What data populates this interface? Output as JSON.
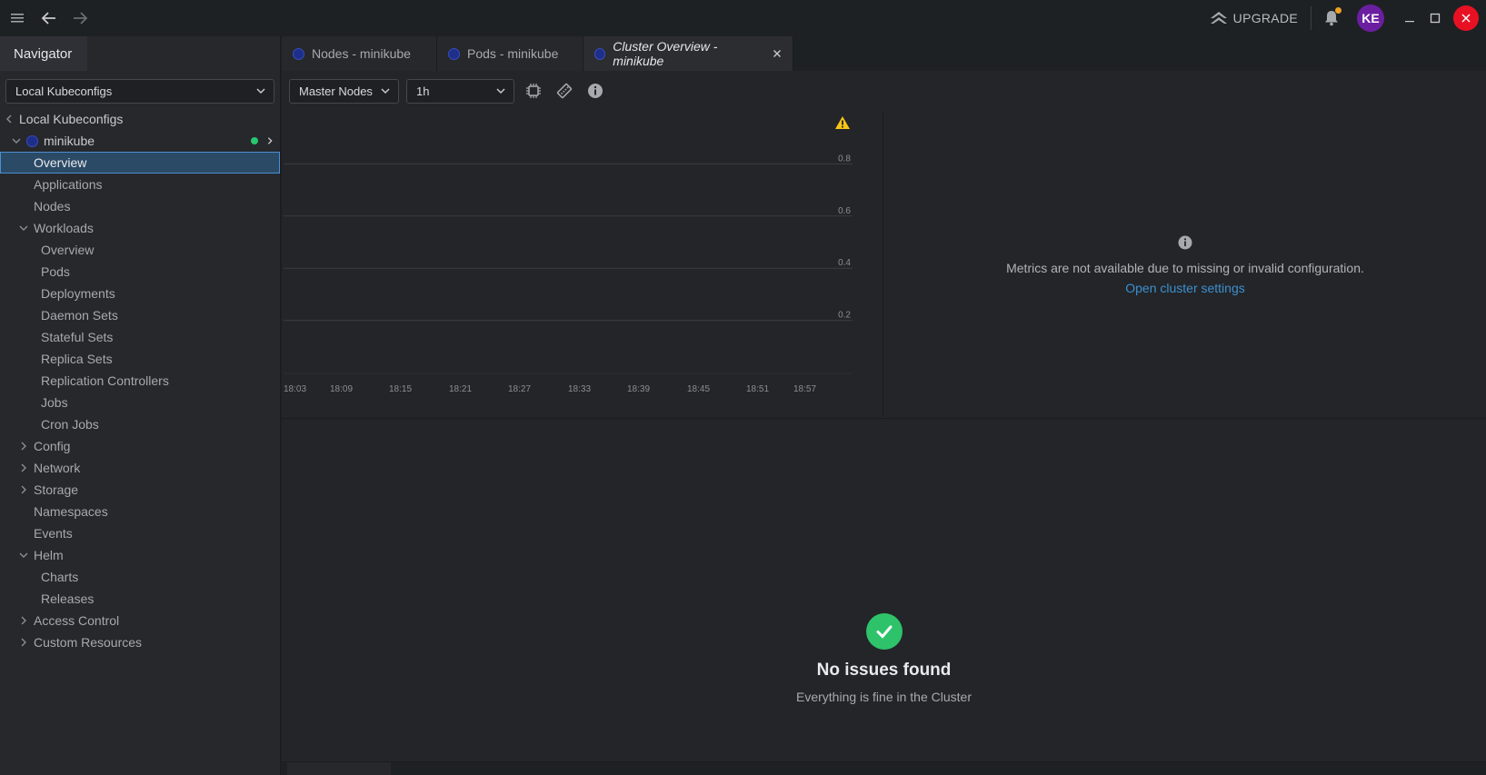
{
  "topbar": {
    "upgrade_label": "UPGRADE",
    "avatar_initials": "KE",
    "avatar_color": "#6b1fa0",
    "notification_dot_color": "#f0a020"
  },
  "sidebar": {
    "header": "Navigator",
    "cluster_select": "Local Kubeconfigs",
    "tree": [
      {
        "label": "Local Kubeconfigs",
        "level": 0,
        "twisty": "left"
      },
      {
        "label": "minikube",
        "level": 1,
        "twisty": "down",
        "icon": "kubernetes-icon",
        "status": "connected"
      },
      {
        "label": "Overview",
        "level": 2,
        "selected": true
      },
      {
        "label": "Applications",
        "level": 2
      },
      {
        "label": "Nodes",
        "level": 2
      },
      {
        "label": "Workloads",
        "level": 2,
        "twisty": "down"
      },
      {
        "label": "Overview",
        "level": 3
      },
      {
        "label": "Pods",
        "level": 3
      },
      {
        "label": "Deployments",
        "level": 3
      },
      {
        "label": "Daemon Sets",
        "level": 3
      },
      {
        "label": "Stateful Sets",
        "level": 3
      },
      {
        "label": "Replica Sets",
        "level": 3
      },
      {
        "label": "Replication Controllers",
        "level": 3
      },
      {
        "label": "Jobs",
        "level": 3
      },
      {
        "label": "Cron Jobs",
        "level": 3
      },
      {
        "label": "Config",
        "level": 2,
        "twisty": "right"
      },
      {
        "label": "Network",
        "level": 2,
        "twisty": "right"
      },
      {
        "label": "Storage",
        "level": 2,
        "twisty": "right"
      },
      {
        "label": "Namespaces",
        "level": 2
      },
      {
        "label": "Events",
        "level": 2
      },
      {
        "label": "Helm",
        "level": 2,
        "twisty": "down"
      },
      {
        "label": "Charts",
        "level": 3
      },
      {
        "label": "Releases",
        "level": 3
      },
      {
        "label": "Access Control",
        "level": 2,
        "twisty": "right"
      },
      {
        "label": "Custom Resources",
        "level": 2,
        "twisty": "right"
      }
    ]
  },
  "tabs": [
    {
      "label": "Nodes - minikube",
      "active": false
    },
    {
      "label": "Pods - minikube",
      "active": false
    },
    {
      "label": "Cluster Overview - minikube",
      "active": true,
      "closable": true
    }
  ],
  "toolbar": {
    "node_select": "Master Nodes",
    "range_select": "1h"
  },
  "chart_data": {
    "type": "line",
    "x": [
      "18:03",
      "18:09",
      "18:15",
      "18:21",
      "18:27",
      "18:33",
      "18:39",
      "18:45",
      "18:51",
      "18:57"
    ],
    "y_ticks": [
      "0.8",
      "0.6",
      "0.4",
      "0.2"
    ],
    "series": [],
    "grid": true,
    "warning": true
  },
  "metrics": {
    "message": "Metrics are not available due to missing or invalid configuration.",
    "link": "Open cluster settings"
  },
  "issues": {
    "title": "No issues found",
    "subtitle": "Everything is fine in the Cluster"
  },
  "colors": {
    "accent": "#3d90ce",
    "success": "#2ec36a",
    "warning": "#f5c518",
    "close": "#e81123"
  }
}
